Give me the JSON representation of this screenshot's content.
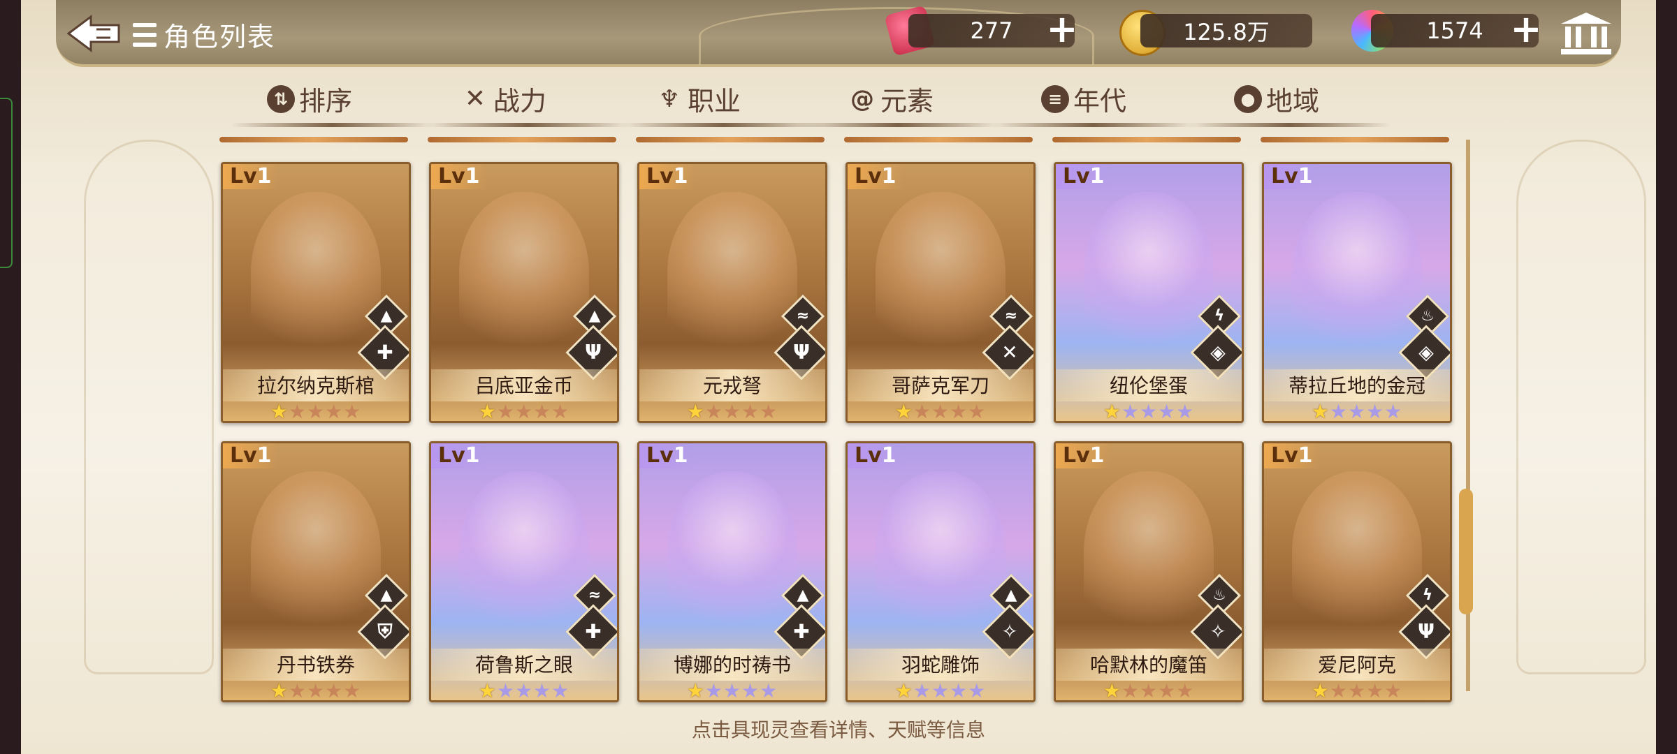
{
  "header": {
    "title": "角色列表",
    "resources": [
      {
        "name": "stamina",
        "icon": "can-icon",
        "value": "277"
      },
      {
        "name": "gold",
        "icon": "coin-icon",
        "value": "125.8万"
      },
      {
        "name": "gem",
        "icon": "rainbow-gem-icon",
        "value": "1574"
      }
    ]
  },
  "tabs": [
    {
      "label": "排序",
      "icon": "sort-icon"
    },
    {
      "label": "战力",
      "icon": "swords-icon"
    },
    {
      "label": "职业",
      "icon": "class-icon"
    },
    {
      "label": "元素",
      "icon": "element-icon"
    },
    {
      "label": "年代",
      "icon": "calendar-icon"
    },
    {
      "label": "地域",
      "icon": "location-icon"
    }
  ],
  "cards": [
    {
      "level_prefix": "Lv",
      "level": "1",
      "name": "拉尔纳克斯棺",
      "rarity": 1,
      "theme": "gold",
      "element_badge": "mountain-icon",
      "class_badge": "cross-icon"
    },
    {
      "level_prefix": "Lv",
      "level": "1",
      "name": "吕底亚金币",
      "rarity": 1,
      "theme": "gold",
      "element_badge": "mountain-icon",
      "class_badge": "trident-icon"
    },
    {
      "level_prefix": "Lv",
      "level": "1",
      "name": "元戎弩",
      "rarity": 1,
      "theme": "gold",
      "element_badge": "wind-icon",
      "class_badge": "trident-icon"
    },
    {
      "level_prefix": "Lv",
      "level": "1",
      "name": "哥萨克军刀",
      "rarity": 1,
      "theme": "gold",
      "element_badge": "wind-icon",
      "class_badge": "crossed-swords-icon"
    },
    {
      "level_prefix": "Lv",
      "level": "1",
      "name": "纽伦堡蛋",
      "rarity": 1,
      "theme": "purple",
      "element_badge": "lightning-icon",
      "class_badge": "book-icon"
    },
    {
      "level_prefix": "Lv",
      "level": "1",
      "name": "蒂拉丘地的金冠",
      "rarity": 1,
      "theme": "purple",
      "element_badge": "fire-icon",
      "class_badge": "book-icon"
    },
    {
      "level_prefix": "Lv",
      "level": "1",
      "name": "丹书铁券",
      "rarity": 1,
      "theme": "gold",
      "element_badge": "mountain-icon",
      "class_badge": "shield-icon"
    },
    {
      "level_prefix": "Lv",
      "level": "1",
      "name": "荷鲁斯之眼",
      "rarity": 1,
      "theme": "purple",
      "element_badge": "wind-icon",
      "class_badge": "cross-icon"
    },
    {
      "level_prefix": "Lv",
      "level": "1",
      "name": "博娜的时祷书",
      "rarity": 1,
      "theme": "purple",
      "element_badge": "mountain-icon",
      "class_badge": "cross-icon"
    },
    {
      "level_prefix": "Lv",
      "level": "1",
      "name": "羽蛇雕饰",
      "rarity": 1,
      "theme": "purple",
      "element_badge": "mountain-icon",
      "class_badge": "dove-icon"
    },
    {
      "level_prefix": "Lv",
      "level": "1",
      "name": "哈默林的魔笛",
      "rarity": 1,
      "theme": "gold",
      "element_badge": "fire-icon",
      "class_badge": "dove-icon"
    },
    {
      "level_prefix": "Lv",
      "level": "1",
      "name": "爱尼阿克",
      "rarity": 1,
      "theme": "gold",
      "element_badge": "lightning-icon",
      "class_badge": "trident-icon"
    }
  ],
  "max_stars": 5,
  "footer": {
    "hint": "点击具现灵查看详情、天赋等信息"
  },
  "colors": {
    "accent_gold": "#d9a64f",
    "text_brown": "#5a4030",
    "star_on": "#ffd33a"
  }
}
